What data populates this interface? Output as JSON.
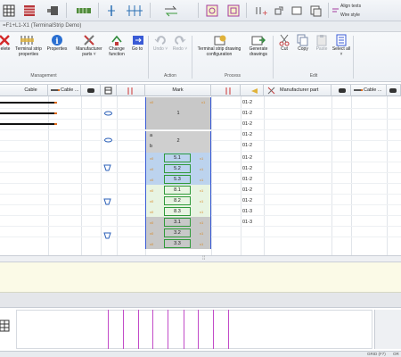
{
  "toolbar": {
    "align_texts": "Align texts",
    "wire_style": "Wire style"
  },
  "window": {
    "title": "=F1+L1-X1 (TerminalStrip Demo)"
  },
  "ribbon": {
    "buttons": {
      "delete": "elete",
      "terminal_strip_properties": "Terminal strip properties",
      "properties": "Properties",
      "manufacturer_parts": "Manufacturer parts ˅",
      "change_function": "Change function",
      "go_to": "Go to",
      "undo": "Undo ˅",
      "redo": "Redo ˅",
      "terminal_strip_drawing_configuration": "Terminal strip drawing configuration",
      "generate_drawings": "Generate drawings",
      "cut": "Cut",
      "copy": "Copy",
      "paste": "Paste",
      "select_all": "Select all ˅"
    },
    "groups": {
      "management": "Management",
      "action": "Action",
      "process": "Process",
      "edit": "Edit"
    }
  },
  "grid": {
    "headers": {
      "cable": "Cable",
      "cable_2": "Cable ...",
      "mark": "Mark",
      "manufacturer_part": "Manufacturer part",
      "cable_3": "Cable ..."
    },
    "rows": [
      {
        "mark": "1",
        "sheet": "01-2",
        "pin_l": "x0",
        "pin_r": "x1"
      },
      {
        "mark": "",
        "sheet": "01-2"
      },
      {
        "mark": "",
        "sheet": "01-2"
      },
      {
        "mark": "2",
        "sheet": "01-2",
        "sub_a": "a",
        "sub_b": "b"
      },
      {
        "mark": "",
        "sheet": "01-2"
      },
      {
        "mark": "5.1",
        "sheet": "01-2",
        "pin_l": "x0",
        "pin_r": "x1"
      },
      {
        "mark": "5.2",
        "sheet": "01-2",
        "pin_l": "x0",
        "pin_r": "x1"
      },
      {
        "mark": "5.3",
        "sheet": "01-2",
        "pin_l": "x0",
        "pin_r": "x1"
      },
      {
        "mark": "8.1",
        "sheet": "01-2",
        "pin_l": "x0",
        "pin_r": "x1"
      },
      {
        "mark": "8.2",
        "sheet": "01-2",
        "pin_l": "x0",
        "pin_r": "x1"
      },
      {
        "mark": "8.3",
        "sheet": "01-3",
        "pin_l": "x0",
        "pin_r": "x1"
      },
      {
        "mark": "3.1",
        "sheet": "01-3",
        "pin_l": "x0",
        "pin_r": "x1"
      },
      {
        "mark": "3.2",
        "sheet": "",
        "pin_l": "x0",
        "pin_r": "x1"
      },
      {
        "mark": "3.3",
        "sheet": "",
        "pin_l": "x0",
        "pin_r": "x1"
      }
    ]
  },
  "statusbar": {
    "grid": "GRID (F7)",
    "extra": "OR"
  },
  "colors": {
    "accent_blue": "#3a5bd6",
    "group_gray": "#c8c8c8",
    "group_blue": "#bcd3ee",
    "group_green": "#d6efcf",
    "marker_line": "#c24bc8"
  }
}
